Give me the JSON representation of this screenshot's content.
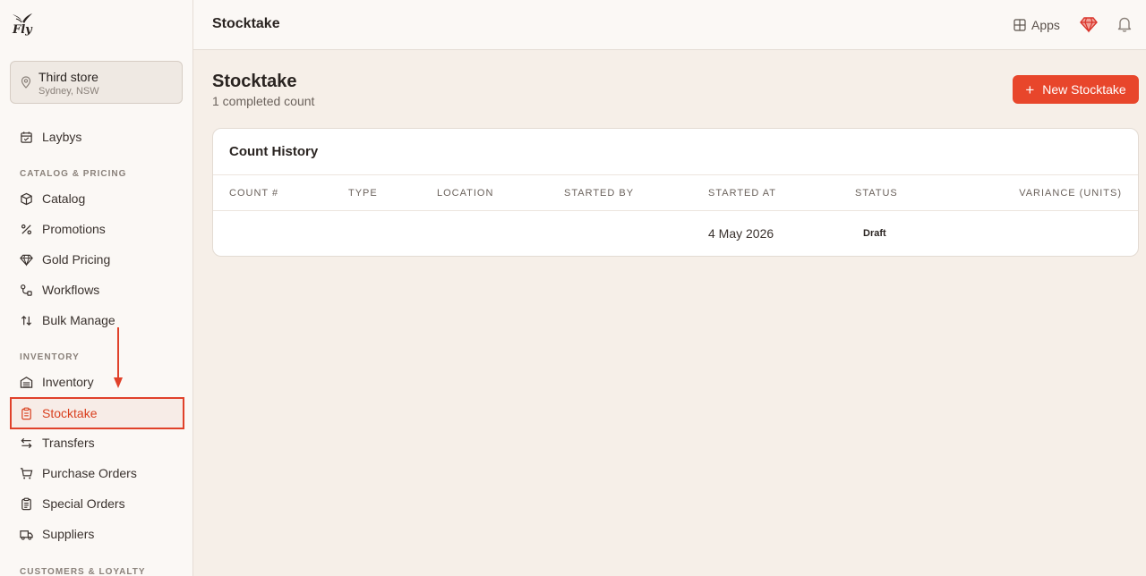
{
  "brand": {
    "logo_text": "Fly"
  },
  "store": {
    "name": "Third store",
    "location": "Sydney, NSW"
  },
  "sidebar": {
    "top_items": [
      {
        "label": "Laybys",
        "icon": "calendar-icon"
      }
    ],
    "sections": [
      {
        "title": "CATALOG & PRICING",
        "items": [
          {
            "label": "Catalog",
            "icon": "box-icon"
          },
          {
            "label": "Promotions",
            "icon": "percent-icon"
          },
          {
            "label": "Gold Pricing",
            "icon": "diamond-icon"
          },
          {
            "label": "Workflows",
            "icon": "workflow-icon"
          },
          {
            "label": "Bulk Manage",
            "icon": "arrows-up-down-icon"
          }
        ]
      },
      {
        "title": "INVENTORY",
        "items": [
          {
            "label": "Inventory",
            "icon": "warehouse-icon"
          },
          {
            "label": "Stocktake",
            "icon": "clipboard-icon",
            "active": true
          },
          {
            "label": "Transfers",
            "icon": "transfer-icon"
          },
          {
            "label": "Purchase Orders",
            "icon": "cart-icon"
          },
          {
            "label": "Special Orders",
            "icon": "clipboard-list-icon"
          },
          {
            "label": "Suppliers",
            "icon": "truck-icon"
          }
        ]
      },
      {
        "title": "CUSTOMERS & LOYALTY",
        "items": []
      }
    ]
  },
  "header": {
    "title": "Stocktake",
    "apps_label": "Apps"
  },
  "page": {
    "title": "Stocktake",
    "subtitle": "1 completed count",
    "new_button_label": "New Stocktake"
  },
  "table": {
    "title": "Count History",
    "columns": [
      "COUNT #",
      "TYPE",
      "LOCATION",
      "STARTED BY",
      "STARTED AT",
      "STATUS",
      "VARIANCE (UNITS)"
    ],
    "rows": [
      {
        "count": "",
        "type": "",
        "location": "",
        "started_by": "",
        "started_at": "4 May 2026",
        "status": "Draft",
        "variance": ""
      }
    ]
  },
  "colors": {
    "accent": "#e8462b",
    "active_border": "#e0412a",
    "background": "#f6efe8"
  }
}
